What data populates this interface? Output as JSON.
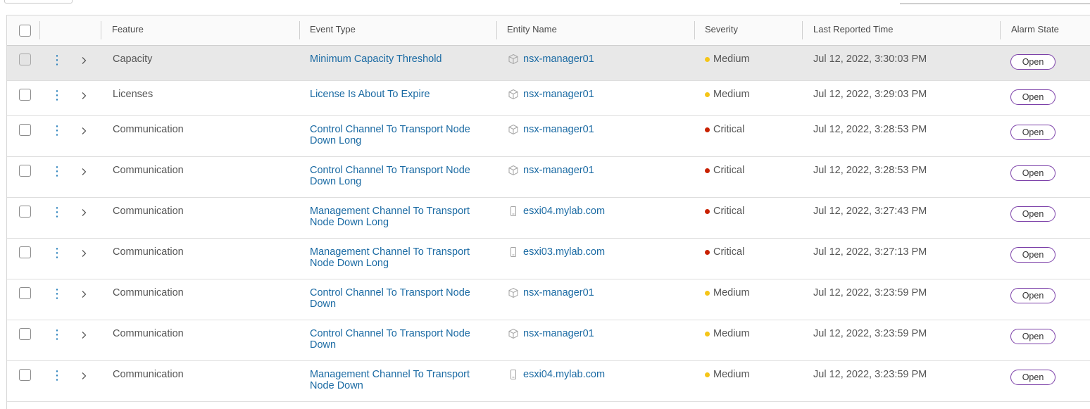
{
  "columns": [
    "Feature",
    "Event Type",
    "Entity Name",
    "Severity",
    "Last Reported Time",
    "Alarm State"
  ],
  "colors": {
    "medium": "#f5c518",
    "critical": "#c92100",
    "link": "#1a6aa3",
    "pill_border": "#7b3fa8"
  },
  "rows": [
    {
      "feature": "Capacity",
      "event_type": "Minimum Capacity Threshold",
      "entity": "nsx-manager01",
      "entity_icon": "cube-icon",
      "severity": "Medium",
      "time": "Jul 12, 2022, 3:30:03 PM",
      "state": "Open"
    },
    {
      "feature": "Licenses",
      "event_type": "License Is About To Expire",
      "entity": "nsx-manager01",
      "entity_icon": "cube-icon",
      "severity": "Medium",
      "time": "Jul 12, 2022, 3:29:03 PM",
      "state": "Open"
    },
    {
      "feature": "Communication",
      "event_type": "Control Channel To Transport Node Down Long",
      "entity": "nsx-manager01",
      "entity_icon": "cube-icon",
      "severity": "Critical",
      "time": "Jul 12, 2022, 3:28:53 PM",
      "state": "Open"
    },
    {
      "feature": "Communication",
      "event_type": "Control Channel To Transport Node Down Long",
      "entity": "nsx-manager01",
      "entity_icon": "cube-icon",
      "severity": "Critical",
      "time": "Jul 12, 2022, 3:28:53 PM",
      "state": "Open"
    },
    {
      "feature": "Communication",
      "event_type": "Management Channel To Transport Node Down Long",
      "entity": "esxi04.mylab.com",
      "entity_icon": "host-icon",
      "severity": "Critical",
      "time": "Jul 12, 2022, 3:27:43 PM",
      "state": "Open"
    },
    {
      "feature": "Communication",
      "event_type": "Management Channel To Transport Node Down Long",
      "entity": "esxi03.mylab.com",
      "entity_icon": "host-icon",
      "severity": "Critical",
      "time": "Jul 12, 2022, 3:27:13 PM",
      "state": "Open"
    },
    {
      "feature": "Communication",
      "event_type": "Control Channel To Transport Node Down",
      "entity": "nsx-manager01",
      "entity_icon": "cube-icon",
      "severity": "Medium",
      "time": "Jul 12, 2022, 3:23:59 PM",
      "state": "Open"
    },
    {
      "feature": "Communication",
      "event_type": "Control Channel To Transport Node Down",
      "entity": "nsx-manager01",
      "entity_icon": "cube-icon",
      "severity": "Medium",
      "time": "Jul 12, 2022, 3:23:59 PM",
      "state": "Open"
    },
    {
      "feature": "Communication",
      "event_type": "Management Channel To Transport Node Down",
      "entity": "esxi04.mylab.com",
      "entity_icon": "host-icon",
      "severity": "Medium",
      "time": "Jul 12, 2022, 3:23:59 PM",
      "state": "Open"
    }
  ]
}
